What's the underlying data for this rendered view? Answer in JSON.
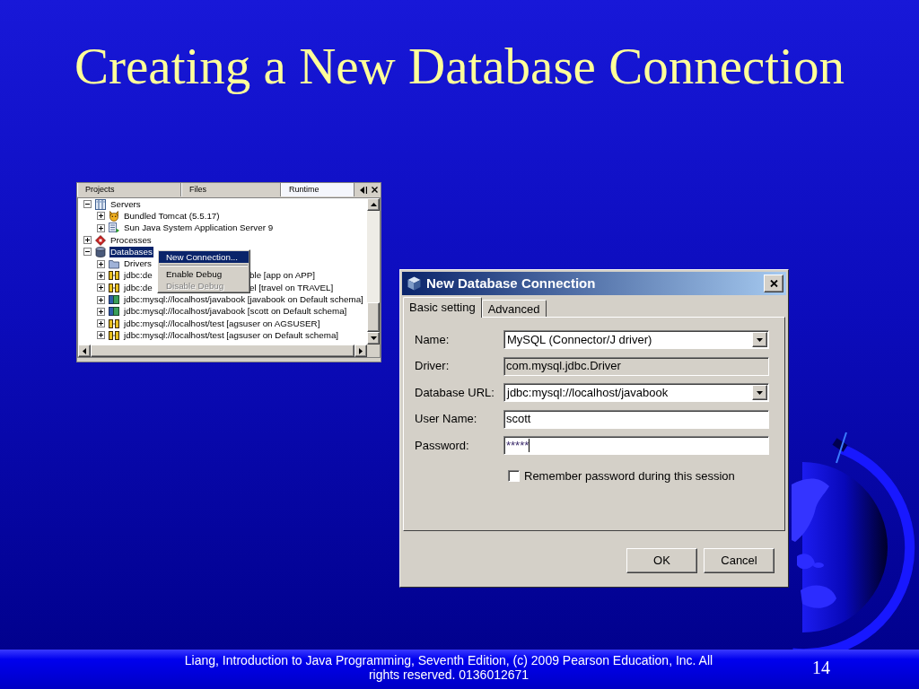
{
  "slide": {
    "title": "Creating a New Database Connection"
  },
  "ide_panel": {
    "tabs": [
      {
        "label": "Projects",
        "selected": false
      },
      {
        "label": "Files",
        "selected": false
      },
      {
        "label": "Runtime",
        "selected": true
      }
    ],
    "tree": [
      {
        "kind": "servers",
        "label": "Servers",
        "expanded": true,
        "selected": false,
        "children": [
          {
            "kind": "tomcat",
            "label": "Bundled Tomcat (5.5.17)",
            "expanded": false,
            "selected": false
          },
          {
            "kind": "appserver",
            "label": "Sun Java System Application Server 9",
            "expanded": false,
            "selected": false
          }
        ]
      },
      {
        "kind": "processes",
        "label": "Processes",
        "expanded": false,
        "selected": false
      },
      {
        "kind": "databases",
        "label": "Databases",
        "expanded": true,
        "selected": true,
        "children": [
          {
            "kind": "drivers",
            "label": "Drivers",
            "expanded": false,
            "selected": false
          },
          {
            "kind": "connection",
            "connected": false,
            "label": "jdbc:de",
            "label_after_menu": "ble [app on APP]",
            "expanded": false,
            "selected": false
          },
          {
            "kind": "connection",
            "connected": false,
            "label": "jdbc:de",
            "label_after_menu": "el [travel on TRAVEL]",
            "expanded": false,
            "selected": false
          },
          {
            "kind": "connection",
            "connected": true,
            "label": "jdbc:mysql://localhost/javabook [javabook on Default schema]",
            "expanded": false,
            "selected": false
          },
          {
            "kind": "connection",
            "connected": true,
            "label": "jdbc:mysql://localhost/javabook [scott on Default schema]",
            "expanded": false,
            "selected": false
          },
          {
            "kind": "connection",
            "connected": false,
            "label": "jdbc:mysql://localhost/test [agsuser on AGSUSER]",
            "expanded": false,
            "selected": false
          },
          {
            "kind": "connection",
            "connected": false,
            "label": "jdbc:mysql://localhost/test [agsuser on Default schema]",
            "expanded": false,
            "selected": false
          }
        ]
      }
    ],
    "context_menu": [
      {
        "kind": "item",
        "label": "New Connection...",
        "selected": true,
        "disabled": false
      },
      {
        "kind": "separator"
      },
      {
        "kind": "item",
        "label": "Enable Debug",
        "selected": false,
        "disabled": false
      },
      {
        "kind": "item",
        "label": "Disable Debug",
        "selected": false,
        "disabled": true
      }
    ]
  },
  "dialog": {
    "title": "New Database Connection",
    "tabs": [
      {
        "label": "Basic setting",
        "selected": true
      },
      {
        "label": "Advanced",
        "selected": false
      }
    ],
    "fields": [
      {
        "kind": "combo",
        "label": "Name:",
        "value": "MySQL (Connector/J driver)",
        "focused": false
      },
      {
        "kind": "readonly",
        "label": "Driver:",
        "value": "com.mysql.jdbc.Driver",
        "focused": false
      },
      {
        "kind": "combo",
        "label": "Database URL:",
        "value": "jdbc:mysql://localhost/javabook",
        "focused": false
      },
      {
        "kind": "text",
        "label": "User Name:",
        "value": "scott",
        "focused": false
      },
      {
        "kind": "password",
        "label": "Password:",
        "value": "*****",
        "focused": true
      }
    ],
    "remember": {
      "label": "Remember password during this session",
      "checked": false
    },
    "buttons": [
      "OK",
      "Cancel"
    ]
  },
  "footer": {
    "credit": "Liang, Introduction to Java Programming, Seventh Edition, (c) 2009 Pearson Education, Inc. All rights reserved. 0136012671",
    "page_number": "14"
  }
}
